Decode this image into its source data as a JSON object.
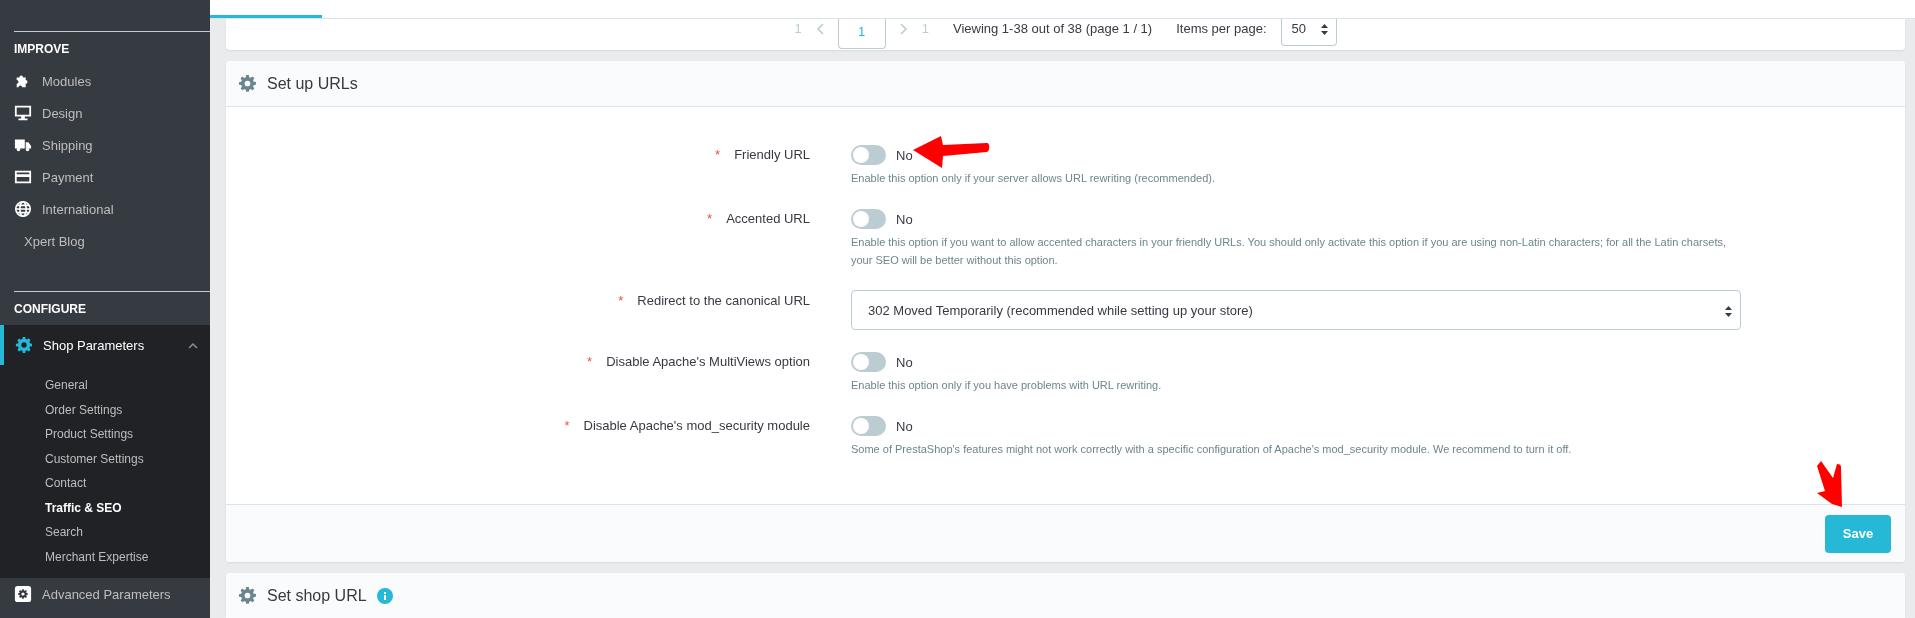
{
  "sidebar": {
    "sections": [
      {
        "title": "IMPROVE",
        "items": [
          {
            "label": "Modules",
            "selected": false
          },
          {
            "label": "Design",
            "selected": false
          },
          {
            "label": "Shipping",
            "selected": false
          },
          {
            "label": "Payment",
            "selected": false
          },
          {
            "label": "International",
            "selected": false
          },
          {
            "label": "Xpert Blog",
            "selected": false
          }
        ]
      },
      {
        "title": "CONFIGURE",
        "items": [
          {
            "label": "Shop Parameters",
            "selected": true,
            "expanded": true,
            "children": [
              {
                "label": "General",
                "selected": false
              },
              {
                "label": "Order Settings",
                "selected": false
              },
              {
                "label": "Product Settings",
                "selected": false
              },
              {
                "label": "Customer Settings",
                "selected": false
              },
              {
                "label": "Contact",
                "selected": false
              },
              {
                "label": "Traffic & SEO",
                "selected": true
              },
              {
                "label": "Search",
                "selected": false
              },
              {
                "label": "Merchant Expertise",
                "selected": false
              }
            ]
          },
          {
            "label": "Advanced Parameters",
            "selected": false
          }
        ]
      }
    ]
  },
  "pagination": {
    "first": "1",
    "current": "1",
    "last": "1",
    "summary": "Viewing 1-38 out of 38 (page 1 / 1)",
    "per_page_label": "Items per page:",
    "per_page": "50"
  },
  "setup_panel": {
    "title": "Set up URLs",
    "fields": [
      {
        "kind": "toggle",
        "label": "Friendly URL",
        "required_mark": "*",
        "on": false,
        "value": "No",
        "marked": true,
        "help": "Enable this option only if your server allows URL rewriting (recommended)."
      },
      {
        "kind": "toggle",
        "label": "Accented URL",
        "required_mark": "*",
        "on": false,
        "value": "No",
        "help": "Enable this option if you want to allow accented characters in your friendly URLs. You should only activate this option if you are using non-Latin characters; for all the Latin charsets, your SEO will be better without this option."
      },
      {
        "kind": "select",
        "label": "Redirect to the canonical URL",
        "required_mark": "*",
        "value": "302 Moved Temporarily (recommended while setting up your store)"
      },
      {
        "kind": "toggle",
        "label": "Disable Apache's MultiViews option",
        "required_mark": "*",
        "on": false,
        "value": "No",
        "help": "Enable this option only if you have problems with URL rewriting."
      },
      {
        "kind": "toggle",
        "label": "Disable Apache's mod_security module",
        "required_mark": "*",
        "on": false,
        "value": "No",
        "help": "Some of PrestaShop's features might not work correctly with a specific configuration of Apache's mod_security module. We recommend to turn it off."
      }
    ],
    "save": {
      "label": "Save",
      "marked": true
    }
  },
  "shop_url_panel": {
    "title": "Set shop URL"
  }
}
